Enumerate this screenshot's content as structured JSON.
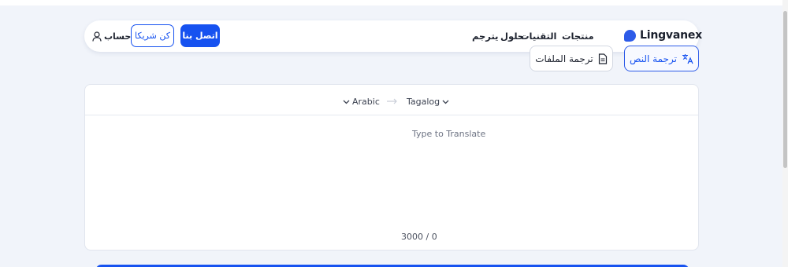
{
  "header": {
    "logo_text": "Lingvanex",
    "nav": [
      {
        "label": "منتجات",
        "has_caret": true
      },
      {
        "label": "التقنيات",
        "has_caret": true
      },
      {
        "label": "حلول",
        "has_caret": true
      },
      {
        "label": "يترجم",
        "has_caret": true
      }
    ],
    "contact_label": "اتصل بنا",
    "partner_label": "كن شريكا",
    "account_label": "حساب"
  },
  "modes": {
    "text_label": "ترجمة النص",
    "files_label": "ترجمة الملفات"
  },
  "translator": {
    "source_lang": "Arabic",
    "target_lang": "Tagalog",
    "placeholder": "Type to Translate",
    "counter": "3000 / 0"
  },
  "colors": {
    "accent": "#1652f0",
    "background": "#f1f4fa",
    "card": "#ffffff"
  },
  "icons": [
    "user-icon",
    "translate-icon",
    "document-icon",
    "chevron-down-icon",
    "swap-arrow-icon"
  ]
}
